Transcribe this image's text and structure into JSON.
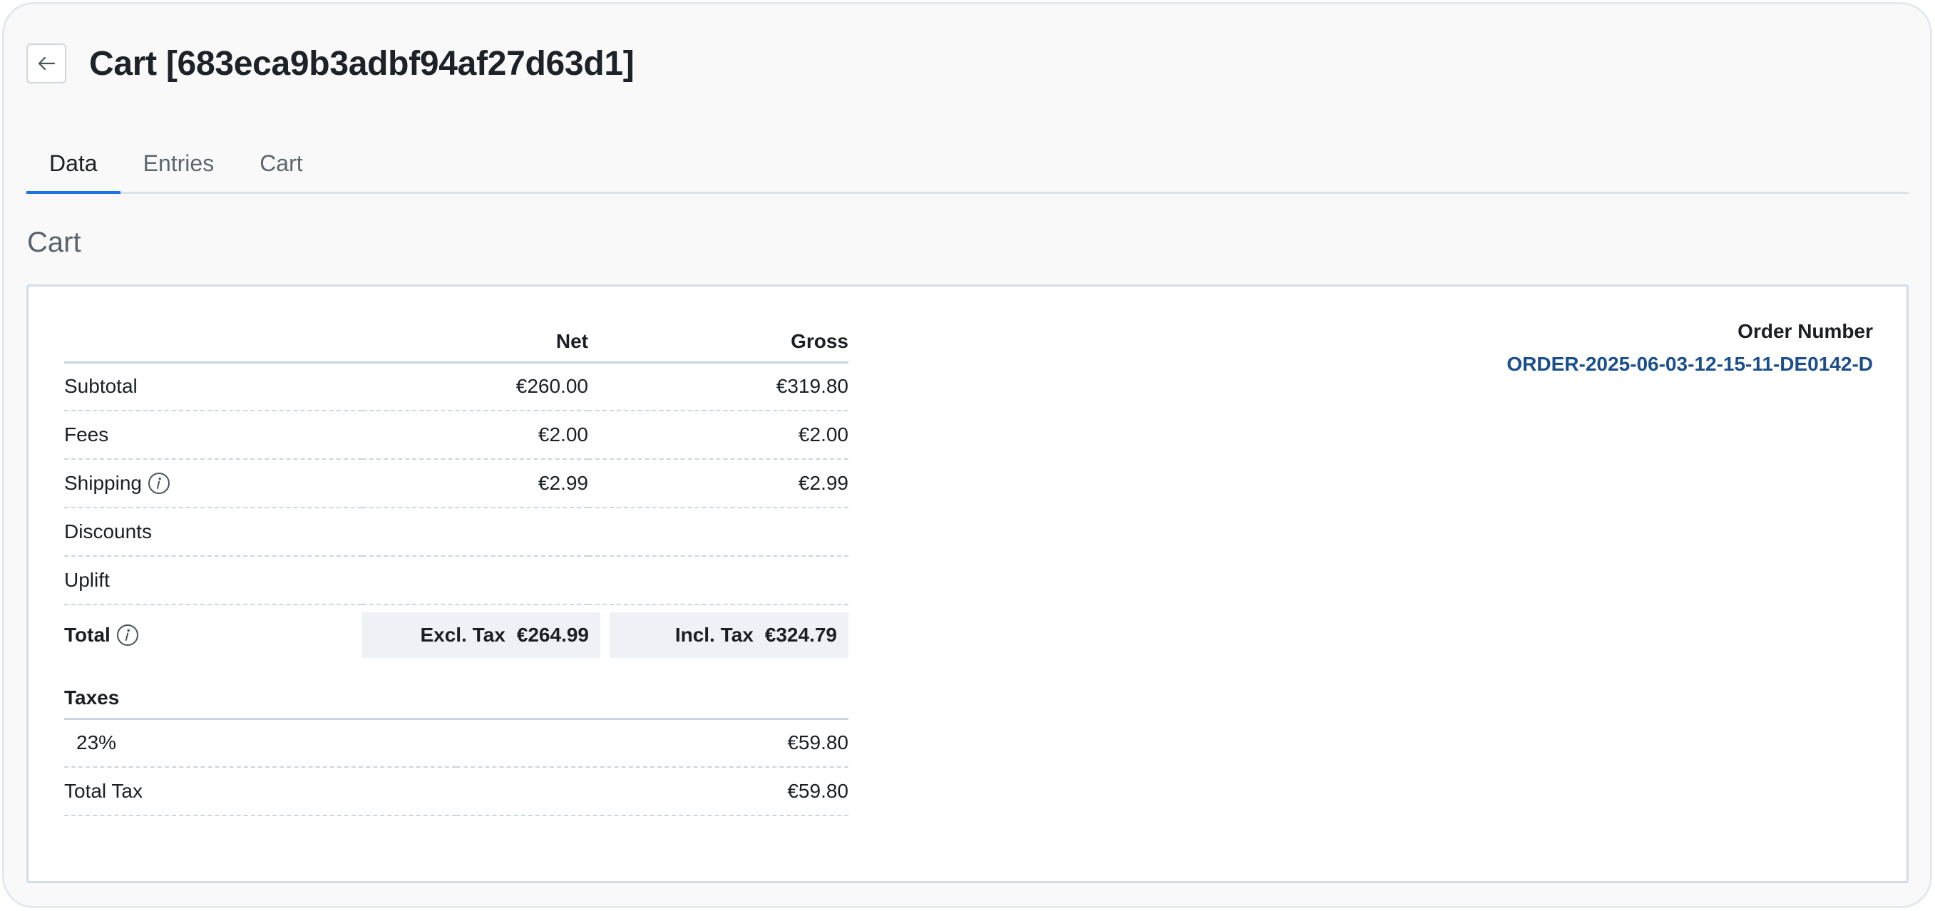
{
  "header": {
    "title": "Cart [683eca9b3adbf94af27d63d1]",
    "back_icon": "arrow-left-icon"
  },
  "tabs": [
    {
      "label": "Data",
      "active": true
    },
    {
      "label": "Entries",
      "active": false
    },
    {
      "label": "Cart",
      "active": false
    }
  ],
  "section": {
    "title": "Cart"
  },
  "prices": {
    "columns": {
      "net": "Net",
      "gross": "Gross"
    },
    "rows": [
      {
        "label": "Subtotal",
        "net": "€260.00",
        "gross": "€319.80"
      },
      {
        "label": "Fees",
        "net": "€2.00",
        "gross": "€2.00"
      },
      {
        "label": "Shipping",
        "net": "€2.99",
        "gross": "€2.99",
        "icon": "info-icon"
      },
      {
        "label": "Discounts",
        "net": "",
        "gross": ""
      },
      {
        "label": "Uplift",
        "net": "",
        "gross": ""
      }
    ],
    "total": {
      "label": "Total",
      "excl_label": "Excl. Tax",
      "excl_value": "€264.99",
      "incl_label": "Incl. Tax",
      "incl_value": "€324.79"
    }
  },
  "taxes": {
    "heading": "Taxes",
    "rows": [
      {
        "rate": "23%",
        "amount": "€59.80"
      }
    ],
    "total_label": "Total Tax",
    "total_amount": "€59.80"
  },
  "order": {
    "label": "Order Number",
    "value": "ORDER-2025-06-03-12-15-11-DE0142-D"
  },
  "colors": {
    "accent": "#1a73e8",
    "link": "#1b4f8c",
    "total_box_bg": "#eef1f5"
  }
}
